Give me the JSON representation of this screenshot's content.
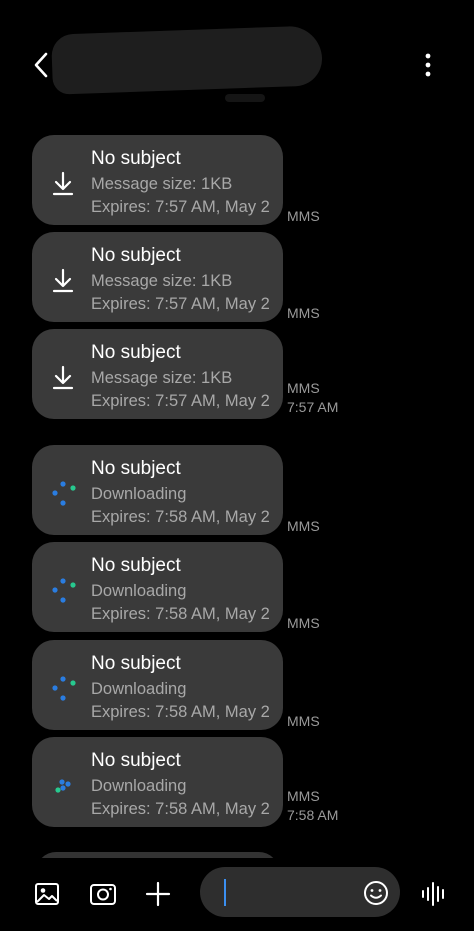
{
  "header": {
    "back_icon": "chevron-left-icon",
    "more_icon": "more-vertical-icon"
  },
  "messages": [
    {
      "title": "No subject",
      "line2": "Message size: 1KB",
      "line3": "Expires: 7:57 AM, May 2",
      "icon": "download-icon",
      "status": "download",
      "meta": "MMS",
      "time": ""
    },
    {
      "title": "No subject",
      "line2": "Message size: 1KB",
      "line3": "Expires: 7:57 AM, May 2",
      "icon": "download-icon",
      "status": "download",
      "meta": "MMS",
      "time": ""
    },
    {
      "title": "No subject",
      "line2": "Message size: 1KB",
      "line3": "Expires: 7:57 AM, May 2",
      "icon": "download-icon",
      "status": "download",
      "meta": "MMS",
      "time": "7:57 AM"
    },
    {
      "title": "No subject",
      "line2": "Downloading",
      "line3": "Expires: 7:58 AM, May 2",
      "icon": "loading-dots-icon",
      "status": "downloading",
      "meta": "MMS",
      "time": ""
    },
    {
      "title": "No subject",
      "line2": "Downloading",
      "line3": "Expires: 7:58 AM, May 2",
      "icon": "loading-dots-icon",
      "status": "downloading",
      "meta": "MMS",
      "time": ""
    },
    {
      "title": "No subject",
      "line2": "Downloading",
      "line3": "Expires: 7:58 AM, May 2",
      "icon": "loading-dots-icon",
      "status": "downloading",
      "meta": "MMS",
      "time": ""
    },
    {
      "title": "No subject",
      "line2": "Downloading",
      "line3": "Expires: 7:58 AM, May 2",
      "icon": "loading-dots-icon",
      "status": "downloading",
      "meta": "MMS",
      "time": "7:58 AM"
    }
  ],
  "composer": {
    "gallery_icon": "image-icon",
    "camera_icon": "camera-icon",
    "add_icon": "plus-icon",
    "emoji_icon": "emoji-icon",
    "voice_icon": "voice-waveform-icon",
    "input_value": ""
  },
  "colors": {
    "accent_blue": "#2a7de1",
    "accent_green": "#27c98f",
    "bubble": "#3a3a3a",
    "background": "#000000"
  }
}
